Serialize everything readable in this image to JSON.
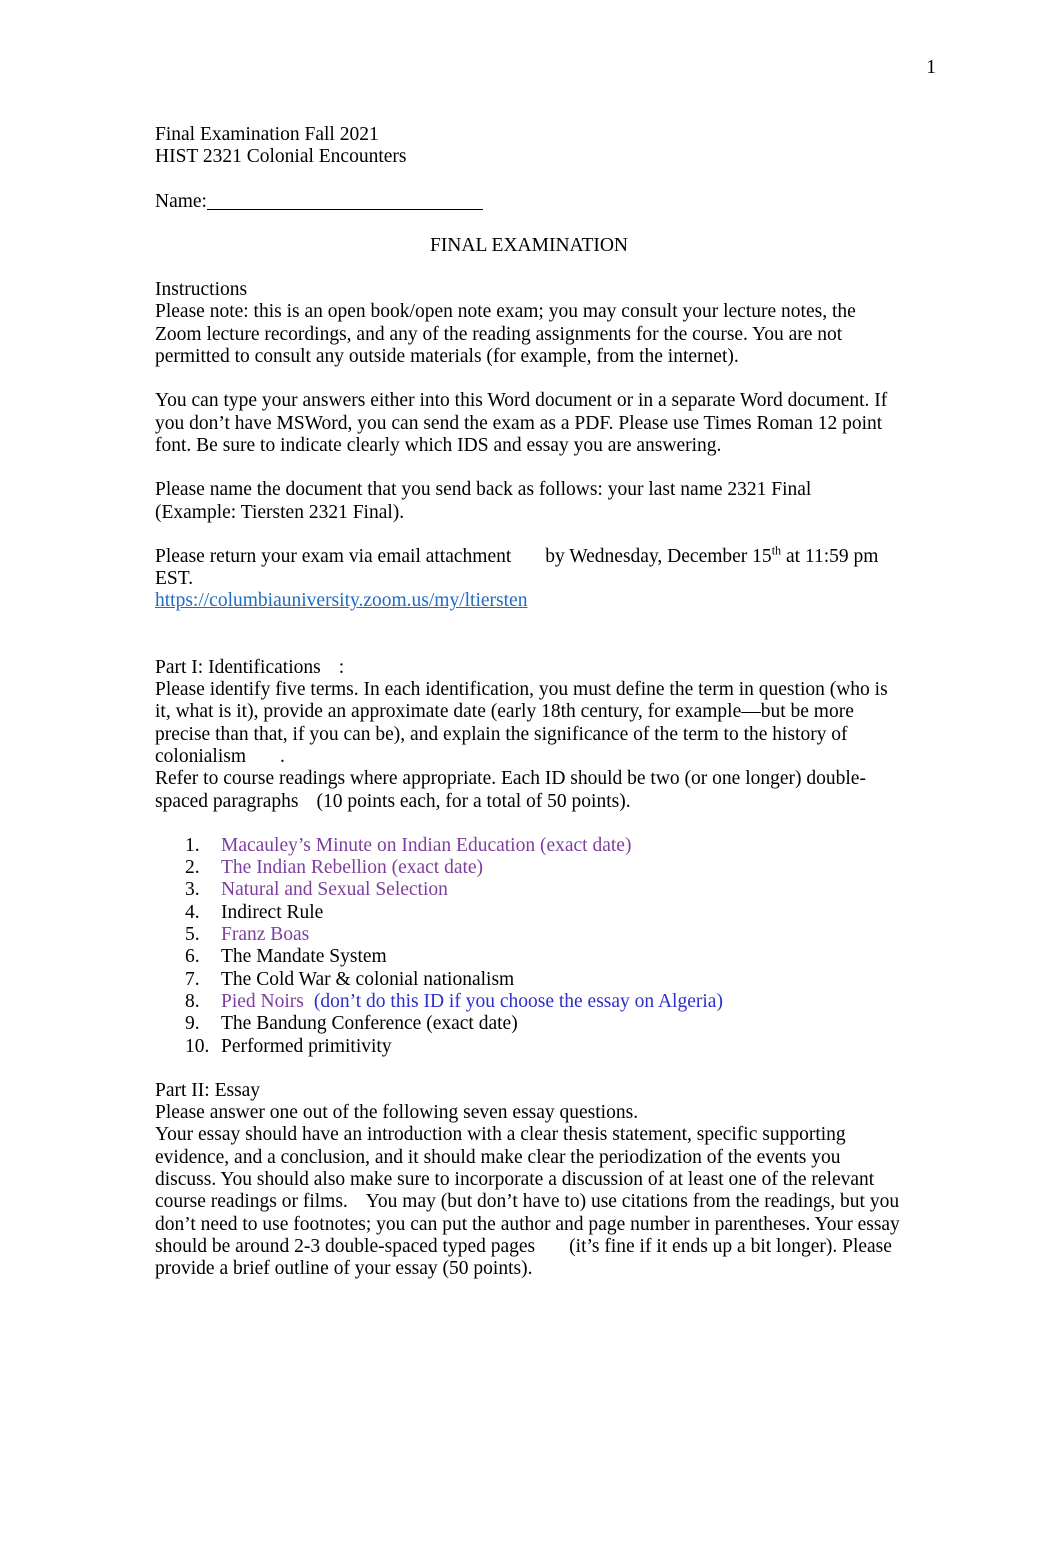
{
  "document": {
    "page_number": "1",
    "header_line_1": "Final Examination Fall 2021",
    "header_line_2": "HIST 2321 Colonial Encounters",
    "name_label": "Name:",
    "title": "FINAL EXAMINATION"
  },
  "instructions": {
    "heading": "Instructions",
    "paragraph_1": "Please note: this is an open book/open note exam; you may consult your lecture notes, the Zoom lecture recordings, and any of the reading assignments for the course. You are not permitted to consult any outside materials (for example, from the internet).",
    "paragraph_2": "You can type your answers either into this Word document or in a separate Word document. If you don’t have MSWord, you can send the exam as a PDF. Please use Times Roman 12 point font. Be sure to indicate clearly which IDS and essay you are answering.",
    "paragraph_3_line_1": "Please name the document that you send back as follows: your last name 2321 Final",
    "paragraph_3_line_2": "(Example: Tiersten 2321 Final).",
    "return_line_part_1": "Please return your exam via email attachment",
    "return_line_part_2": "by Wednesday, December 15",
    "return_line_superscript": "th",
    "return_line_part_3": " at 11:59 pm EST.",
    "zoom_link": "https://columbiauniversity.zoom.us/my/ltiersten"
  },
  "part_one": {
    "heading_text": "Part I: Identifications",
    "heading_colon": ":",
    "paragraph_before_gap": "Please identify five terms. In each identification, you must define the term in question (who is it, what is it), provide an approximate date (early 18th century, for example—but be more precise than that, if you can be), and explain the significance of the term to the history of colonialism",
    "paragraph_after_gap": ".",
    "paragraph_line_3": "Refer to course readings where appropriate. Each ID should be two (or one longer) double-spaced paragraphs",
    "paragraph_points": "(10 points each, for a total of 50 points).",
    "items": [
      {
        "number": "1.",
        "number_color": "purple",
        "text": "Macauley’s Minute on Indian Education (exact date)",
        "color": "purple",
        "extra": "",
        "extra_color": ""
      },
      {
        "number": "2.",
        "number_color": "purple",
        "text": "The Indian Rebellion (exact date)",
        "color": "purple",
        "extra": "",
        "extra_color": ""
      },
      {
        "number": "3.",
        "number_color": "black",
        "text": "Natural and Sexual Selection",
        "color": "purple",
        "extra": "",
        "extra_color": ""
      },
      {
        "number": "4.",
        "number_color": "black",
        "text": "Indirect Rule",
        "color": "black",
        "extra": "",
        "extra_color": ""
      },
      {
        "number": "5.",
        "number_color": "black",
        "text": "Franz Boas",
        "color": "purple",
        "extra": "",
        "extra_color": ""
      },
      {
        "number": "6.",
        "number_color": "black",
        "text": "The Mandate System",
        "color": "black",
        "extra": "",
        "extra_color": ""
      },
      {
        "number": "7.",
        "number_color": "black",
        "text": "The Cold War & colonial nationalism",
        "color": "black",
        "extra": "",
        "extra_color": ""
      },
      {
        "number": "8.",
        "number_color": "black",
        "text": "Pied Noirs",
        "color": "purple",
        "extra": "(don’t do this ID if you choose the essay on Algeria)",
        "extra_color": "blue"
      },
      {
        "number": "9.",
        "number_color": "black",
        "text": "The Bandung Conference (exact date)",
        "color": "black",
        "extra": "",
        "extra_color": ""
      },
      {
        "number": "10.",
        "number_color": "black",
        "text": "Performed primitivity",
        "color": "black",
        "extra": "",
        "extra_color": ""
      }
    ]
  },
  "part_two": {
    "heading": "Part II: Essay",
    "line_1": "Please answer one out of the following seven essay questions.",
    "paragraph_a": "Your essay should have an introduction with a clear thesis statement, specific supporting evidence, and a conclusion, and it should make clear the periodization of the events you discuss. You should also make sure to incorporate a discussion of at least one of the relevant course readings or films.",
    "paragraph_b": "You may (but don’t have to) use citations from the readings, but you don’t need to use footnotes; you can put the author and page number in parentheses. Your essay should be around 2-3 double-spaced typed pages",
    "paragraph_c": "(it’s fine if it ends up a bit longer). Please provide a brief outline of your essay (50 points)."
  },
  "colors": {
    "link_blue": "#1c6bc4",
    "accent_purple": "#7d3f9e",
    "note_blue": "#2d2dcc",
    "text_black": "#000000",
    "page_background": "#ffffff"
  }
}
